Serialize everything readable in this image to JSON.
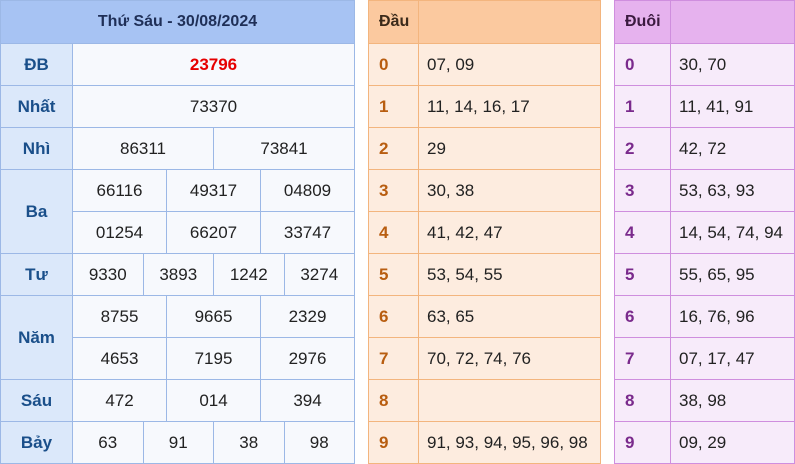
{
  "results": {
    "title": "Thứ Sáu - 30/08/2024",
    "db_label": "ĐB",
    "db": "23796",
    "nhat_label": "Nhất",
    "nhat": "73370",
    "nhi_label": "Nhì",
    "nhi": [
      "86311",
      "73841"
    ],
    "ba_label": "Ba",
    "ba": [
      "66116",
      "49317",
      "04809",
      "01254",
      "66207",
      "33747"
    ],
    "tu_label": "Tư",
    "tu": [
      "9330",
      "3893",
      "1242",
      "3274"
    ],
    "nam_label": "Năm",
    "nam": [
      "8755",
      "9665",
      "2329",
      "4653",
      "7195",
      "2976"
    ],
    "sau_label": "Sáu",
    "sau": [
      "472",
      "014",
      "394"
    ],
    "bay_label": "Bảy",
    "bay": [
      "63",
      "91",
      "38",
      "98"
    ],
    "highlight_color": "#e60000"
  },
  "dau": {
    "header": "Đầu",
    "rows": [
      {
        "k": "0",
        "v": "07, 09"
      },
      {
        "k": "1",
        "v": "11, 14, 16, 17"
      },
      {
        "k": "2",
        "v": "29"
      },
      {
        "k": "3",
        "v": "30, 38"
      },
      {
        "k": "4",
        "v": "41, 42, 47"
      },
      {
        "k": "5",
        "v": "53, 54, 55"
      },
      {
        "k": "6",
        "v": "63, 65"
      },
      {
        "k": "7",
        "v": "70, 72, 74, 76"
      },
      {
        "k": "8",
        "v": ""
      },
      {
        "k": "9",
        "v": "91, 93, 94, 95, 96, 98"
      }
    ]
  },
  "duoi": {
    "header": "Đuôi",
    "rows": [
      {
        "k": "0",
        "v": "30, 70"
      },
      {
        "k": "1",
        "v": "11, 41, 91"
      },
      {
        "k": "2",
        "v": "42, 72"
      },
      {
        "k": "3",
        "v": "53, 63, 93"
      },
      {
        "k": "4",
        "v": "14, 54, 74, 94"
      },
      {
        "k": "5",
        "v": "55, 65, 95"
      },
      {
        "k": "6",
        "v": "16, 76, 96"
      },
      {
        "k": "7",
        "v": "07, 17, 47"
      },
      {
        "k": "8",
        "v": "38, 98"
      },
      {
        "k": "9",
        "v": "09, 29"
      }
    ]
  }
}
